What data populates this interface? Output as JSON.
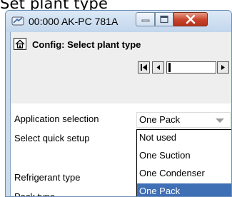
{
  "page_title": "Set plant type",
  "window": {
    "title": "00:000 AK-PC 781A",
    "icons": {
      "app": "controller-icon",
      "minimize": "minimize-icon",
      "maximize": "maximize-icon",
      "close": "close-icon"
    }
  },
  "config": {
    "title": "Config: Select plant type",
    "home_icon": "home-icon"
  },
  "navigation": {
    "first": "first-page-icon",
    "prev": "prev-page-icon",
    "next": "next-page-icon"
  },
  "fields": [
    {
      "label": "Application selection",
      "value": "One Pack"
    },
    {
      "label": "Select quick setup",
      "value": ""
    },
    {
      "label": "Refrigerant type",
      "value": ""
    },
    {
      "label": "Pack type",
      "value": ""
    }
  ],
  "dropdown": {
    "options": [
      "Not used",
      "One Suction",
      "One Condenser",
      "One Pack"
    ],
    "selected_index": 3
  },
  "colors": {
    "selection": "#3f6fb5",
    "close_button": "#c8432b",
    "window_frame": "#c9dbee"
  }
}
